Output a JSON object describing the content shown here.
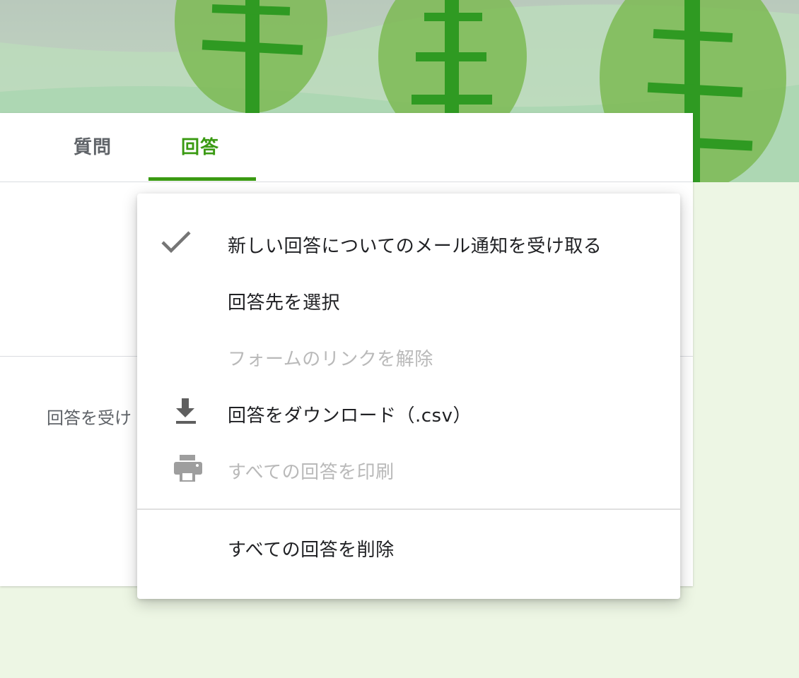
{
  "tabs": {
    "questions_label": "質問",
    "responses_label": "回答",
    "active": "responses"
  },
  "card": {
    "accepting_label_partial": "回答を受け"
  },
  "menu": {
    "items": [
      {
        "label": "新しい回答についてのメール通知を受け取る",
        "icon": "check-icon",
        "checked": true,
        "enabled": true
      },
      {
        "label": "回答先を選択",
        "icon": null,
        "enabled": true
      },
      {
        "label": "フォームのリンクを解除",
        "icon": null,
        "enabled": false
      },
      {
        "label": "回答をダウンロード（.csv）",
        "icon": "download-icon",
        "enabled": true
      },
      {
        "label": "すべての回答を印刷",
        "icon": "print-icon",
        "enabled": false
      },
      {
        "label": "すべての回答を削除",
        "icon": null,
        "enabled": true
      }
    ]
  },
  "colors": {
    "accent": "#3a9a12",
    "page_background": "#edf6e4",
    "text_primary": "#202124",
    "text_secondary": "#5f6368",
    "text_disabled": "#b9b9b9"
  }
}
